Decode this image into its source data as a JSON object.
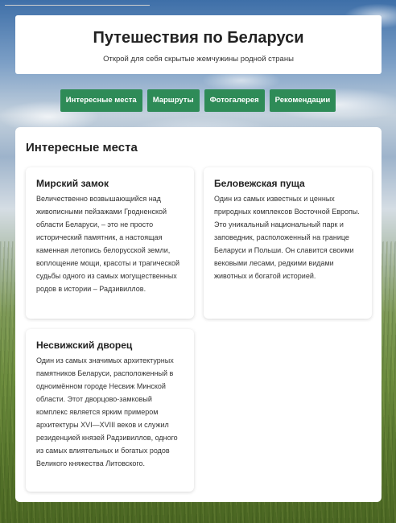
{
  "header": {
    "title": "Путешествия по Беларуси",
    "subtitle": "Открой для себя скрытые жемчужины родной страны"
  },
  "nav": {
    "items": [
      {
        "label": "Интересные места"
      },
      {
        "label": "Маршруты"
      },
      {
        "label": "Фотогалерея"
      },
      {
        "label": "Рекомендации"
      }
    ]
  },
  "main": {
    "section_title": "Интересные места",
    "cards": [
      {
        "title": "Мирский замок",
        "text": "Величественно возвышающийся над живописными пейзажами Гродненской области Беларуси, – это не просто исторический памятник, а настоящая каменная летопись белорусской земли, воплощение мощи, красоты и трагической судьбы одного из самых могущественных родов в истории – Радзивиллов."
      },
      {
        "title": "Беловежская пуща",
        "text": "Один из самых известных и ценных природных комплексов Восточной Европы. Это уникальный национальный парк и заповедник, расположенный на границе Беларуси и Польши. Он славится своими вековыми лесами, редкими видами животных и богатой историей."
      },
      {
        "title": "Несвижский дворец",
        "text": "Один из самых значимых архитектурных памятников Беларуси, расположенный в одноимённом городе Несвиж Минской области. Этот дворцово-замковый комплекс является ярким примером архитектуры XVI—XVIII веков и служил резиденцией князей Радзивиллов, одного из самых влиятельных и богатых родов Великого княжества Литовского."
      }
    ]
  },
  "colors": {
    "nav_button": "#2e8b57",
    "panel": "#ffffff",
    "text": "#222222"
  }
}
